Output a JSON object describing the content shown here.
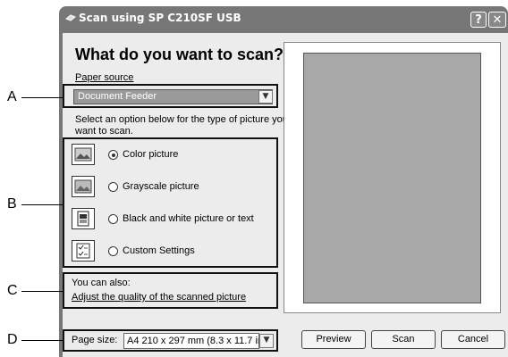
{
  "window": {
    "title": "Scan using SP C210SF USB",
    "help_label": "?",
    "close_label": "✕"
  },
  "main": {
    "heading": "What do you want to scan?",
    "paper_source_label": "Paper source",
    "paper_source_value": "Document Feeder",
    "instruction_line1": "Select an option below for the type of picture you",
    "instruction_line2": "want to scan.",
    "options": [
      {
        "label": "Color picture",
        "selected": true,
        "icon": "color-picture-icon"
      },
      {
        "label": "Grayscale picture",
        "selected": false,
        "icon": "grayscale-picture-icon"
      },
      {
        "label": "Black and white picture or text",
        "selected": false,
        "icon": "black-white-text-icon"
      },
      {
        "label": "Custom Settings",
        "selected": false,
        "icon": "custom-settings-icon"
      }
    ],
    "also_label": "You can also:",
    "adjust_link": "Adjust the quality of the scanned picture",
    "page_size_label": "Page size:",
    "page_size_value": "A4 210 x 297 mm (8.3 x 11.7 inc"
  },
  "buttons": {
    "preview": "Preview",
    "scan": "Scan",
    "cancel": "Cancel"
  },
  "callouts": [
    "A",
    "B",
    "C",
    "D"
  ]
}
